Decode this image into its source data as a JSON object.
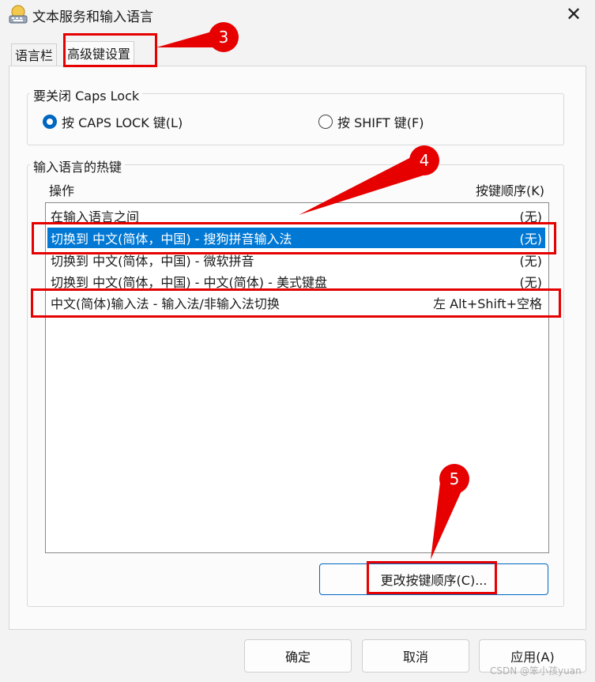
{
  "window": {
    "title": "文本服务和输入语言"
  },
  "tabs": [
    {
      "label": "语言栏"
    },
    {
      "label": "高级键设置"
    }
  ],
  "caps_group": {
    "legend": "要关闭 Caps Lock",
    "options": [
      {
        "label": "按 CAPS LOCK 键(L)",
        "checked": true
      },
      {
        "label": "按 SHIFT 键(F)",
        "checked": false
      }
    ]
  },
  "hotkey_group": {
    "legend": "输入语言的热键",
    "columns": {
      "action": "操作",
      "keys": "按键顺序(K)"
    },
    "rows": [
      {
        "action": "在输入语言之间",
        "keys": "(无)"
      },
      {
        "action": "切换到 中文(简体，中国) - 搜狗拼音输入法",
        "keys": "(无)"
      },
      {
        "action": "切换到 中文(简体，中国) - 微软拼音",
        "keys": "(无)"
      },
      {
        "action": "切换到 中文(简体，中国) - 中文(简体) - 美式键盘",
        "keys": "(无)"
      },
      {
        "action": "中文(简体)输入法 - 输入法/非输入法切换",
        "keys": "左 Alt+Shift+空格"
      }
    ],
    "selected_row": 1,
    "change_button": "更改按键顺序(C)..."
  },
  "footer": {
    "ok": "确定",
    "cancel": "取消",
    "apply": "应用(A)"
  },
  "annotations": {
    "step3": "3",
    "step4": "4",
    "step5": "5"
  },
  "watermark": "CSDN @笨小孩yuan",
  "colors": {
    "selection": "#0078d4",
    "annotation_red": "#e60000",
    "accent": "#0067c0"
  }
}
